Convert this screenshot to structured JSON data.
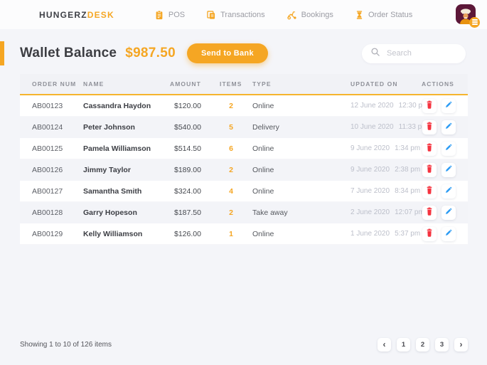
{
  "colors": {
    "accent": "#F5A623",
    "danger": "#F5333F",
    "info": "#2D9CF4",
    "avatar_bg": "#5C1738",
    "header_underline": "#F5B52E"
  },
  "brand": {
    "name_primary": "HUNGERZ",
    "name_secondary": "DESK"
  },
  "nav": {
    "items": [
      {
        "label": "POS",
        "icon": "pos-icon"
      },
      {
        "label": "Transactions",
        "icon": "transactions-icon"
      },
      {
        "label": "Bookings",
        "icon": "bookings-icon"
      },
      {
        "label": "Order Status",
        "icon": "order-status-icon"
      }
    ],
    "avatar": {
      "icon": "chef-avatar",
      "badge_icon": "hamburger-menu-icon"
    }
  },
  "header": {
    "title": "Wallet Balance",
    "balance": "$987.50",
    "send_button_label": "Send to Bank"
  },
  "search": {
    "placeholder": "Search",
    "icon": "search-icon"
  },
  "table": {
    "columns": [
      "ORDER NUM",
      "NAME",
      "AMOUNT",
      "ITEMS",
      "TYPE",
      "UPDATED ON",
      "ACTIONS"
    ],
    "action_icons": [
      "trash-icon",
      "pencil-icon"
    ],
    "rows": [
      {
        "order_num": "AB00123",
        "name": "Cassandra Haydon",
        "amount": "$120.00",
        "items": "2",
        "type": "Online",
        "updated_date": "12 June 2020",
        "updated_time": "12:30 pm"
      },
      {
        "order_num": "AB00124",
        "name": "Peter Johnson",
        "amount": "$540.00",
        "items": "5",
        "type": "Delivery",
        "updated_date": "10 June 2020",
        "updated_time": "11:33 pm"
      },
      {
        "order_num": "AB00125",
        "name": "Pamela Williamson",
        "amount": "$514.50",
        "items": "6",
        "type": "Online",
        "updated_date": "9 June 2020",
        "updated_time": "1:34 pm"
      },
      {
        "order_num": "AB00126",
        "name": "Jimmy Taylor",
        "amount": "$189.00",
        "items": "2",
        "type": "Online",
        "updated_date": "9 June 2020",
        "updated_time": "2:38 pm"
      },
      {
        "order_num": "AB00127",
        "name": "Samantha Smith",
        "amount": "$324.00",
        "items": "4",
        "type": "Online",
        "updated_date": "7 June 2020",
        "updated_time": "8:34 pm"
      },
      {
        "order_num": "AB00128",
        "name": "Garry Hopeson",
        "amount": "$187.50",
        "items": "2",
        "type": "Take away",
        "updated_date": "2 June 2020",
        "updated_time": "12:07 pm"
      },
      {
        "order_num": "AB00129",
        "name": "Kelly Williamson",
        "amount": "$126.00",
        "items": "1",
        "type": "Online",
        "updated_date": "1 June 2020",
        "updated_time": "5:37 pm"
      }
    ]
  },
  "footer": {
    "showing_text": "Showing 1 to 10 of 126 items",
    "pagination": {
      "prev_label": "‹",
      "pages": [
        "1",
        "2",
        "3"
      ],
      "next_label": "›"
    }
  }
}
